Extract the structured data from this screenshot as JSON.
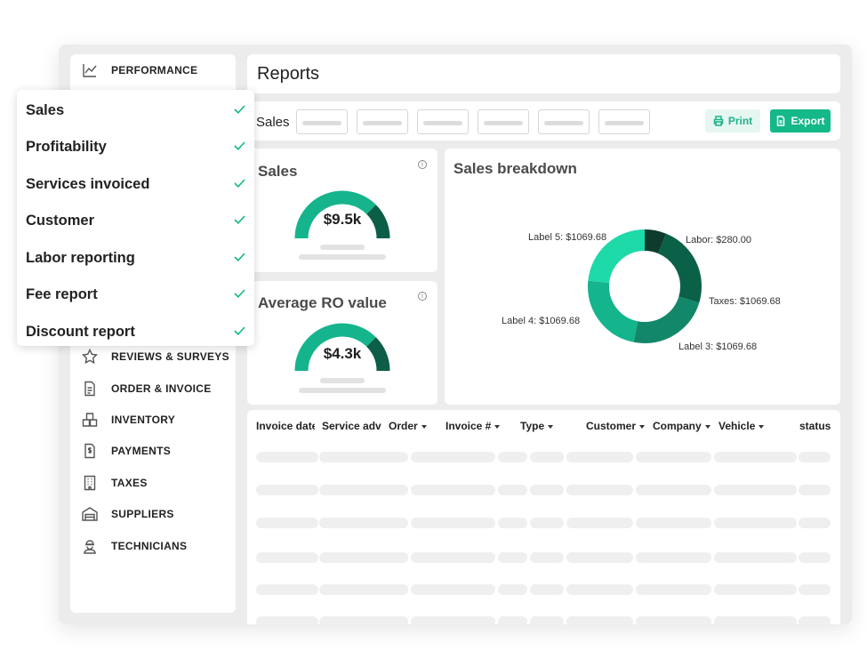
{
  "sidebar": {
    "items": [
      {
        "label": "PERFORMANCE",
        "icon": "trend-line-icon"
      },
      {
        "label": "REVIEWS & SURVEYS",
        "icon": "star-icon"
      },
      {
        "label": "ORDER & INVOICE",
        "icon": "document-icon"
      },
      {
        "label": "INVENTORY",
        "icon": "boxes-icon"
      },
      {
        "label": "PAYMENTS",
        "icon": "dollar-document-icon"
      },
      {
        "label": "TAXES",
        "icon": "building-icon"
      },
      {
        "label": "SUPPLIERS",
        "icon": "warehouse-icon"
      },
      {
        "label": "TECHNICIANS",
        "icon": "technician-icon"
      }
    ]
  },
  "header": {
    "title": "Reports"
  },
  "filters": {
    "label": "Sales",
    "print_label": "Print",
    "export_label": "Export"
  },
  "sales_card": {
    "title": "Sales",
    "value": "$9.5k"
  },
  "ro_card": {
    "title": "Average RO value",
    "value": "$4.3k"
  },
  "breakdown": {
    "title": "Sales breakdown",
    "labels": [
      "Labor: $280.00",
      "Taxes: $1069.68",
      "Label 3: $1069.68",
      "Label 4: $1069.68",
      "Label 5: $1069.68"
    ]
  },
  "chart_data": {
    "type": "pie",
    "title": "Sales breakdown",
    "categories": [
      "Labor",
      "Taxes",
      "Label 3",
      "Label 4",
      "Label 5"
    ],
    "values": [
      280.0,
      1069.68,
      1069.68,
      1069.68,
      1069.68
    ],
    "colors": [
      "#0f3a2e",
      "#0b6048",
      "#13876a",
      "#14b48c",
      "#1ed9a8"
    ]
  },
  "table": {
    "columns": [
      "Invoice date",
      "Service adv",
      "Order",
      "Invoice #",
      "Type",
      "Customer",
      "Company",
      "Vehicle",
      "status"
    ]
  },
  "dropdown": {
    "items": [
      "Sales",
      "Profitability",
      "Services invoiced",
      "Customer",
      "Labor reporting",
      "Fee report",
      "Discount report"
    ]
  },
  "colors": {
    "accent": "#14b889",
    "accent_light": "#e6f7f1"
  }
}
